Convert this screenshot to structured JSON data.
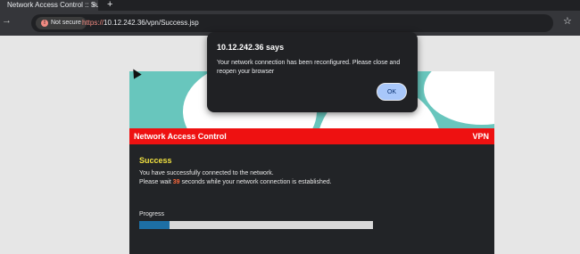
{
  "browser": {
    "tab_title": "Network Access Control :: Succe",
    "tab_close": "×",
    "new_tab": "+",
    "nav_arrow": "→",
    "security_label": "Not secure",
    "url_protocol": "https://",
    "url_rest": "10.12.242.36/vpn/Success.jsp",
    "bookmark_star": "☆"
  },
  "page": {
    "header_left": "Network Access Control",
    "header_right": "VPN",
    "success_title": "Success",
    "line1": "You have successfully connected to the network.",
    "line2_pre": "Please wait ",
    "countdown": "39",
    "line2_post": " seconds while your network connection is established.",
    "progress_label": "Progress",
    "progress_fraction": 0.13,
    "colors": {
      "banner": "#68c6bd",
      "header": "#ee1111",
      "progress": "#1d6fa5",
      "success": "#f0e040",
      "count": "#ff6a3d"
    }
  },
  "dialog": {
    "title": "10.12.242.36 says",
    "message": "Your network connection has been reconfigured. Please close and reopen your browser",
    "ok_label": "OK"
  }
}
